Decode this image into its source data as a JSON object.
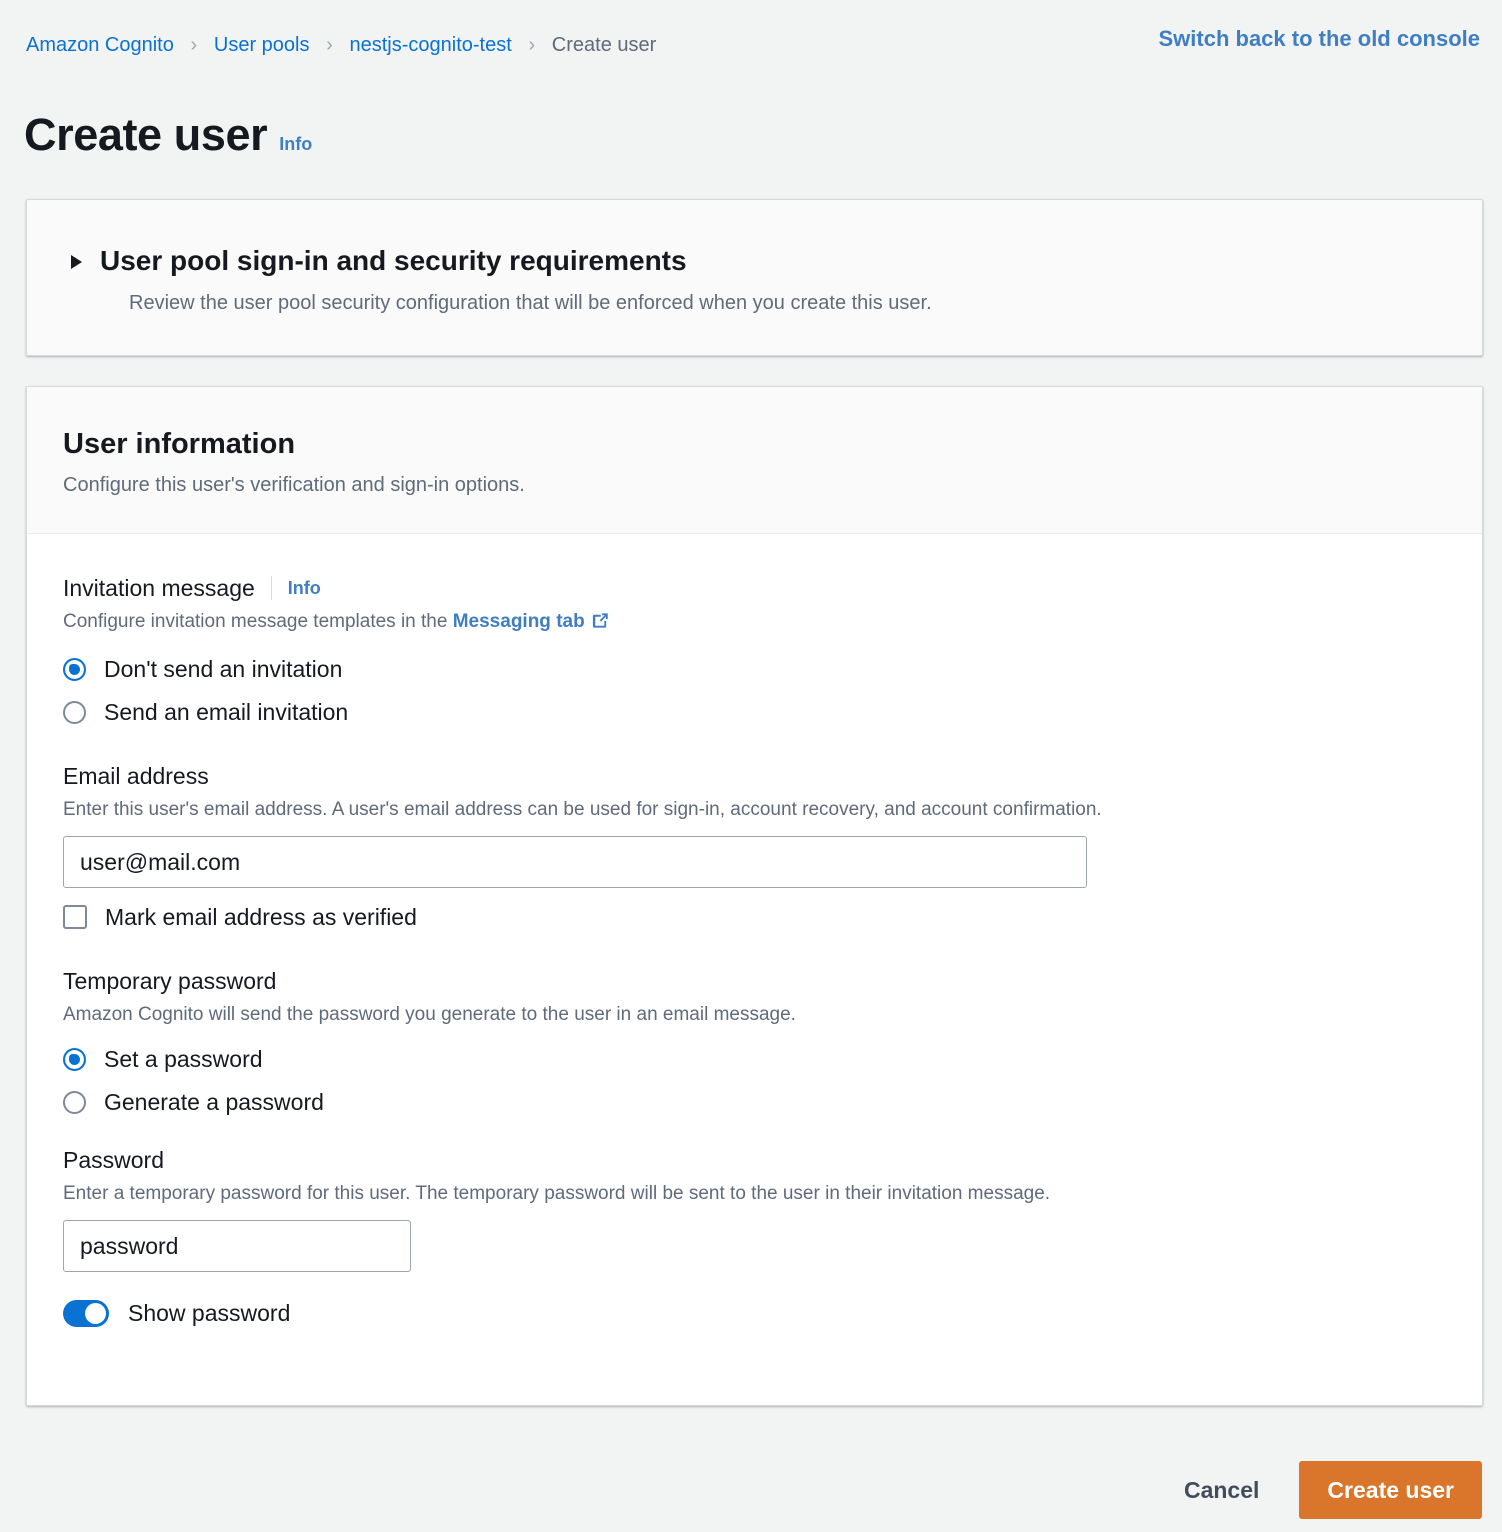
{
  "breadcrumb": {
    "items": [
      {
        "label": "Amazon Cognito",
        "current": false
      },
      {
        "label": "User pools",
        "current": false
      },
      {
        "label": "nestjs-cognito-test",
        "current": false
      },
      {
        "label": "Create user",
        "current": true
      }
    ],
    "separator": "›"
  },
  "header": {
    "old_console_link": "Switch back to the old console",
    "title": "Create user",
    "info_label": "Info"
  },
  "collapsible_section": {
    "title": "User pool sign-in and security requirements",
    "description": "Review the user pool security configuration that will be enforced when you create this user.",
    "expanded": false,
    "caret_icon": "caret-right-icon"
  },
  "user_information": {
    "title": "User information",
    "description": "Configure this user's verification and sign-in options.",
    "invitation_message": {
      "label": "Invitation message",
      "info_label": "Info",
      "description_prefix": "Configure invitation message templates in the ",
      "link_text": "Messaging tab",
      "external_icon": "external-link-icon",
      "options": [
        {
          "label": "Don't send an invitation",
          "selected": true
        },
        {
          "label": "Send an email invitation",
          "selected": false
        }
      ]
    },
    "email_address": {
      "label": "Email address",
      "description": "Enter this user's email address. A user's email address can be used for sign-in, account recovery, and account confirmation.",
      "value": "user@mail.com",
      "placeholder": "",
      "verified_checkbox": {
        "label": "Mark email address as verified",
        "checked": false
      }
    },
    "temporary_password": {
      "label": "Temporary password",
      "description": "Amazon Cognito will send the password you generate to the user in an email message.",
      "options": [
        {
          "label": "Set a password",
          "selected": true
        },
        {
          "label": "Generate a password",
          "selected": false
        }
      ]
    },
    "password": {
      "label": "Password",
      "description": "Enter a temporary password for this user. The temporary password will be sent to the user in their invitation message.",
      "value": "password",
      "placeholder": "",
      "show_password_toggle": {
        "label": "Show password",
        "on": true
      }
    }
  },
  "footer": {
    "cancel_label": "Cancel",
    "submit_label": "Create user"
  },
  "colors": {
    "page_background": "#f2f3f3",
    "link": "#0972d3",
    "link_bright": "#3f7fc1",
    "text_primary": "#16191f",
    "text_secondary": "#5f6b7a",
    "primary_button": "#d9762b",
    "card_border": "#d5dbdb",
    "header_band": "#fafafa"
  }
}
